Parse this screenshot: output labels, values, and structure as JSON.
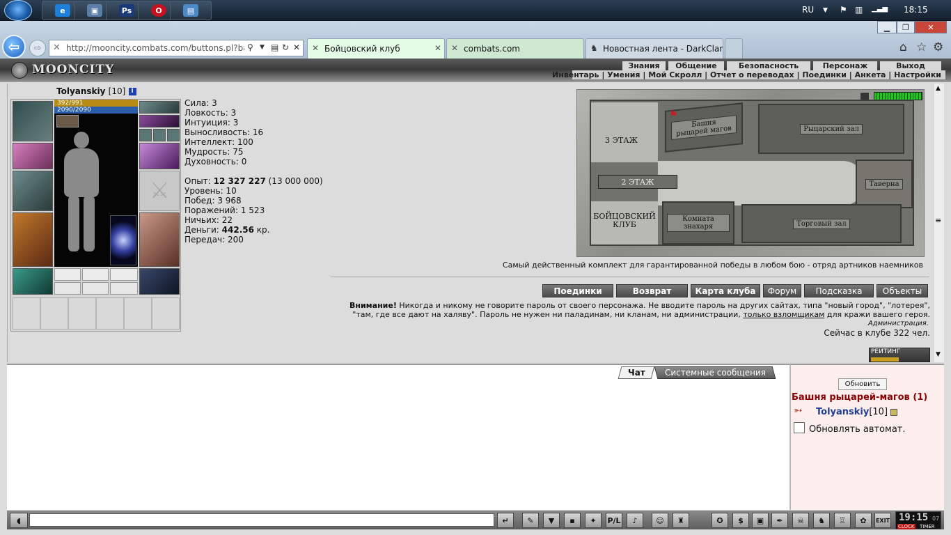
{
  "taskbar": {
    "apps": [
      {
        "name": "ie",
        "label": "e",
        "color": "#1d7fd8"
      },
      {
        "name": "network",
        "label": "▣",
        "color": "#5a7ea8"
      },
      {
        "name": "photoshop",
        "label": "Ps",
        "color": "#1b3a7a"
      },
      {
        "name": "opera",
        "label": "O",
        "color": "#c8101e"
      },
      {
        "name": "monitor",
        "label": "▤",
        "color": "#4d88c6"
      }
    ],
    "lang": "RU",
    "clock": "18:15"
  },
  "browser": {
    "address": "http://mooncity.combats.com/buttons.pl?battle",
    "tabs": [
      {
        "label": "Бойцовский клуб",
        "active": true
      },
      {
        "label": "combats.com",
        "active": false
      },
      {
        "label": "Новостная лента - DarkClan",
        "active": false
      }
    ]
  },
  "site": {
    "logo": "MOONCITY",
    "menu_top": [
      "Знания",
      "Общение",
      "Безопасность",
      "Персонаж",
      "Выход"
    ],
    "menu_sub": [
      "Инвентарь",
      "Умения",
      "Мой Скролл",
      "Отчет о переводах",
      "Поединки",
      "Анкета",
      "Настройки"
    ]
  },
  "character": {
    "name": "Tolyanskiy",
    "level": "[10]",
    "hp": "392/991",
    "mana": "2090/2090",
    "stats": [
      {
        "label": "Сила:",
        "value": "3"
      },
      {
        "label": "Ловкость:",
        "value": "3"
      },
      {
        "label": "Интуиция:",
        "value": "3"
      },
      {
        "label": "Выносливость:",
        "value": "16"
      },
      {
        "label": "Интеллект:",
        "value": "100"
      },
      {
        "label": "Мудрость:",
        "value": "75"
      },
      {
        "label": "Духовность:",
        "value": "0"
      }
    ],
    "exp_label": "Опыт:",
    "exp_value": "12 327 227",
    "exp_next": "(13 000 000)",
    "level_label": "Уровень:",
    "level_value": "10",
    "wins_label": "Побед:",
    "wins_value": "3 968",
    "losses_label": "Поражений:",
    "losses_value": "1 523",
    "draws_label": "Ничьих:",
    "draws_value": "22",
    "money_label": "Деньги:",
    "money_value": "442.56",
    "money_unit": "кр.",
    "transfers_label": "Передач:",
    "transfers_value": "200"
  },
  "map": {
    "floor3": "3 ЭТАЖ",
    "floor2": "2 ЭТАЖ",
    "club": "БОЙЦОВСКИЙ КЛУБ",
    "rooms": {
      "tower": "Башня рыцарей магов",
      "knights": "Рыцарский зал",
      "tavern": "Таверна",
      "healer": "Комната знахаря",
      "trade": "Торговый зал"
    }
  },
  "promo": "Самый действенный комплект для гарантированной победы в любом бою - отряд артников наемников",
  "nav_buttons": [
    "Поединки",
    "Возврат",
    "Карта клуба",
    "Форум",
    "Подсказка",
    "Объекты"
  ],
  "warning": {
    "bold": "Внимание!",
    "text1": "Никогда и никому не говорите пароль от своего персонажа. Не вводите пароль на других сайтах, типа \"новый город\", \"лотерея\", \"там, где все дают на халяву\". Пароль не нужен ни паладинам, ни кланам, ни администрации,",
    "link": "только взломщикам",
    "text2": "для кражи вашего героя.",
    "signature": "Администрация.",
    "online": "Сейчас в клубе 322 чел."
  },
  "rating": "РЕЙТИНГ",
  "chat": {
    "tab_chat": "Чат",
    "tab_system": "Системные сообщения"
  },
  "room_panel": {
    "refresh": "Обновить",
    "room_title": "Башня рыцарей-магов (1)",
    "user": "Tolyanskiy",
    "user_level": "[10]",
    "auto_refresh": "Обновлять автомат."
  },
  "bottom": {
    "clock": "19:15",
    "clock_sec": "07",
    "clock_label": "CLOCK",
    "timer_label": "TIMER",
    "exit": "EXIT"
  }
}
